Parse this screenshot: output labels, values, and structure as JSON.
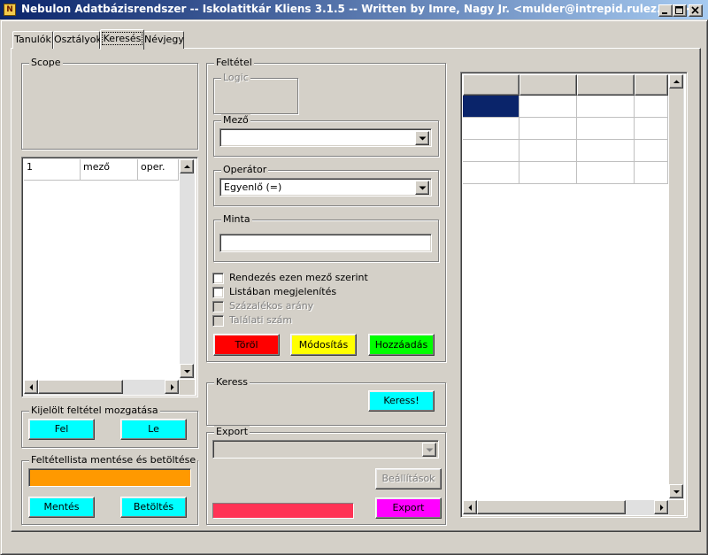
{
  "window": {
    "icon_letter": "N",
    "title": "Nebulon Adatbázisrendszer -- Iskolatitkár Kliens 3.1.5 -- Written by Imre, Nagy Jr. <mulder@intrepid.rulez.org>"
  },
  "tabs": [
    {
      "label": "Tanulók",
      "active": false
    },
    {
      "label": "Osztályok",
      "active": false
    },
    {
      "label": "Keresés",
      "active": true
    },
    {
      "label": "Névjegy",
      "active": false
    }
  ],
  "scope": {
    "label": "Scope"
  },
  "criteria_list": {
    "columns": [
      "1",
      "mező",
      "oper."
    ]
  },
  "move_group": {
    "label": "Kijelölt feltétel mozgatása",
    "up_label": "Fel",
    "down_label": "Le"
  },
  "save_group": {
    "label": "Feltétellista mentése és betöltése",
    "save_label": "Mentés",
    "load_label": "Betöltés"
  },
  "condition": {
    "label": "Feltétel",
    "logic_label": "Logic",
    "field_label": "Mező",
    "field_value": "",
    "operator_label": "Operátor",
    "operator_value": "Egyenlő (=)",
    "pattern_label": "Minta",
    "pattern_value": "",
    "checkboxes": [
      {
        "label": "Rendezés ezen mező szerint",
        "checked": false,
        "enabled": true
      },
      {
        "label": "Listában megjelenítés",
        "checked": false,
        "enabled": true
      },
      {
        "label": "Százalékos arány",
        "checked": false,
        "enabled": false
      },
      {
        "label": "Találati szám",
        "checked": false,
        "enabled": false
      }
    ],
    "delete_label": "Töröl",
    "modify_label": "Módosítás",
    "add_label": "Hozzáadás"
  },
  "search_group": {
    "label": "Keress",
    "search_label": "Keress!"
  },
  "export_group": {
    "label": "Export",
    "format_value": "",
    "settings_label": "Beállítások",
    "export_label": "Export"
  },
  "colors": {
    "cyan": "#00ffff",
    "red": "#ff0000",
    "yellow": "#ffff00",
    "green": "#00ff00",
    "magenta": "#ff00ff",
    "orange": "#ff9900",
    "pink": "#ff3355",
    "selection": "#0a246a"
  },
  "icons": {
    "minimize": "minimize-icon",
    "maximize": "maximize-icon",
    "close": "close-icon",
    "arrow_up": "arrow-up-icon",
    "arrow_down": "arrow-down-icon",
    "arrow_left": "arrow-left-icon",
    "arrow_right": "arrow-right-icon"
  }
}
